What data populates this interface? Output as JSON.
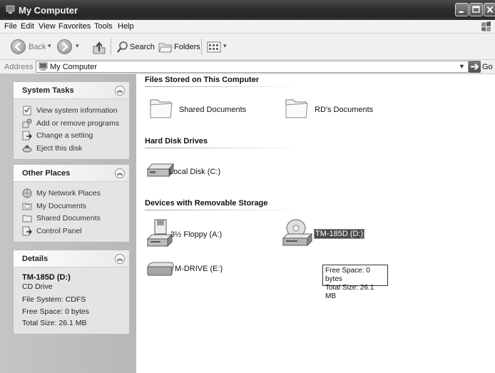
{
  "window": {
    "title": "My Computer"
  },
  "menu": [
    "File",
    "Edit",
    "View",
    "Favorites",
    "Tools",
    "Help"
  ],
  "toolbar": {
    "back_label": "Back",
    "search_label": "Search",
    "folders_label": "Folders"
  },
  "address": {
    "label": "Address",
    "value": "My Computer",
    "go_label": "Go"
  },
  "system_tasks": {
    "title": "System Tasks",
    "items": [
      "View system information",
      "Add or remove programs",
      "Change a setting",
      "Eject this disk"
    ]
  },
  "other_places": {
    "title": "Other Places",
    "items": [
      "My Network Places",
      "My Documents",
      "Shared Documents",
      "Control Panel"
    ]
  },
  "details": {
    "title": "Details",
    "name": "TM-185D (D:)",
    "type": "CD Drive",
    "file_system": "File System: CDFS",
    "free_space": "Free Space: 0 bytes",
    "total_size": "Total Size: 26.1 MB"
  },
  "groups": {
    "stored": {
      "title": "Files Stored on This Computer",
      "items": [
        "Shared Documents",
        "RD's Documents"
      ]
    },
    "hard_disks": {
      "title": "Hard Disk Drives",
      "items": [
        "Local Disk (C:)"
      ]
    },
    "removable": {
      "title": "Devices with Removable Storage",
      "items": [
        "3½ Floppy (A:)",
        "TM-185D (D:)",
        "M-DRIVE (E:)"
      ]
    }
  },
  "tooltip": {
    "line1": "Free Space: 0 bytes",
    "line2": "Total Size: 26.1 MB"
  },
  "colors": {
    "titlebar": "#2e2e2e",
    "leftpane": "#c0c0c0",
    "selection": "#4a4a4a"
  }
}
